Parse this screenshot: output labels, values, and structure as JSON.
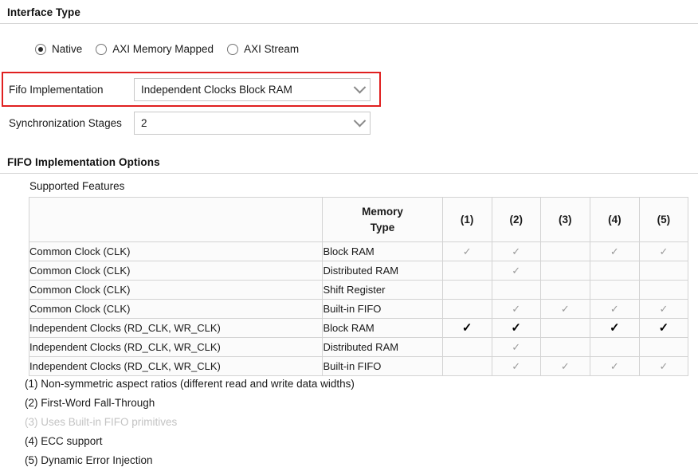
{
  "sections": {
    "interface_type": {
      "title": "Interface Type"
    },
    "fifo_options": {
      "title": "FIFO Implementation Options"
    }
  },
  "interface_type": {
    "options": [
      {
        "label": "Native",
        "selected": true
      },
      {
        "label": "AXI Memory Mapped",
        "selected": false
      },
      {
        "label": "AXI Stream",
        "selected": false
      }
    ]
  },
  "fields": {
    "fifo_implementation": {
      "label": "Fifo Implementation",
      "value": "Independent Clocks Block RAM",
      "arrow_icon": "chevron-down-icon",
      "highlighted": true,
      "highlight_color": "#e02020"
    },
    "synchronization_stages": {
      "label": "Synchronization Stages",
      "value": "2",
      "arrow_icon": "chevron-down-icon"
    }
  },
  "supported_features": {
    "label": "Supported Features",
    "columns": [
      "",
      "Memory\nType",
      "(1)",
      "(2)",
      "(3)",
      "(4)",
      "(5)"
    ],
    "column_memory_type_line1": "Memory",
    "column_memory_type_line2": "Type",
    "column_1": "(1)",
    "column_2": "(2)",
    "column_3": "(3)",
    "column_4": "(4)",
    "column_5": "(5)",
    "check_glyph": "✓",
    "rows": [
      {
        "clock": "Common Clock (CLK)",
        "memory_type": "Block RAM",
        "checks": [
          true,
          true,
          false,
          true,
          true
        ],
        "highlighted": false
      },
      {
        "clock": "Common Clock (CLK)",
        "memory_type": "Distributed RAM",
        "checks": [
          false,
          true,
          false,
          false,
          false
        ],
        "highlighted": false
      },
      {
        "clock": "Common Clock (CLK)",
        "memory_type": "Shift Register",
        "checks": [
          false,
          false,
          false,
          false,
          false
        ],
        "highlighted": false
      },
      {
        "clock": "Common Clock (CLK)",
        "memory_type": "Built-in FIFO",
        "checks": [
          false,
          true,
          true,
          true,
          true
        ],
        "highlighted": false
      },
      {
        "clock": "Independent Clocks (RD_CLK, WR_CLK)",
        "memory_type": "Block RAM",
        "checks": [
          true,
          true,
          false,
          true,
          true
        ],
        "highlighted": true
      },
      {
        "clock": "Independent Clocks (RD_CLK, WR_CLK)",
        "memory_type": "Distributed RAM",
        "checks": [
          false,
          true,
          false,
          false,
          false
        ],
        "highlighted": false
      },
      {
        "clock": "Independent Clocks (RD_CLK, WR_CLK)",
        "memory_type": "Built-in FIFO",
        "checks": [
          false,
          true,
          true,
          true,
          true
        ],
        "highlighted": false
      }
    ]
  },
  "footnotes": [
    {
      "text": "(1) Non-symmetric aspect ratios (different read and write data widths)",
      "disabled": false
    },
    {
      "text": "(2) First-Word Fall-Through",
      "disabled": false
    },
    {
      "text": "(3) Uses Built-in FIFO primitives",
      "disabled": true
    },
    {
      "text": "(4) ECC support",
      "disabled": false
    },
    {
      "text": "(5) Dynamic Error Injection",
      "disabled": false
    }
  ]
}
